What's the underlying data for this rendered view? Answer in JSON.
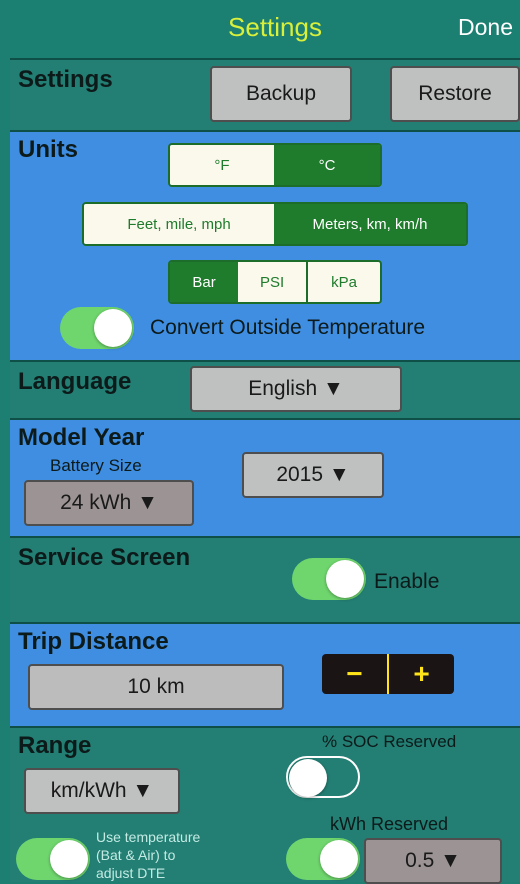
{
  "nav": {
    "title": "Settings",
    "done_label": "Done"
  },
  "settings": {
    "label": "Settings",
    "backup_label": "Backup",
    "restore_label": "Restore"
  },
  "units": {
    "label": "Units",
    "temperature_options": [
      "°F",
      "°C"
    ],
    "temperature_selected": "°C",
    "distance_options": [
      "Feet, mile, mph",
      "Meters, km, km/h"
    ],
    "distance_selected": "Meters, km, km/h",
    "pressure_options": [
      "Bar",
      "PSI",
      "kPa"
    ],
    "pressure_selected": "Bar",
    "convert_temp_label": "Convert Outside Temperature",
    "convert_temp_on": true
  },
  "language": {
    "label": "Language",
    "value": "English ▼"
  },
  "model_year": {
    "label": "Model Year",
    "battery_size_label": "Battery Size",
    "battery_size_value": "24 kWh ▼",
    "year_value": "2015 ▼"
  },
  "service_screen": {
    "label": "Service Screen",
    "enable_label": "Enable",
    "enabled": true
  },
  "trip_distance": {
    "label": "Trip Distance",
    "value": "10 km",
    "minus": "−",
    "plus": "+"
  },
  "range": {
    "label": "Range",
    "unit_value": "km/kWh ▼",
    "soc_reserved_label": "% SOC Reserved",
    "soc_reserved_on": false,
    "use_temp_line1": "Use temperature",
    "use_temp_line2": "(Bat & Air) to",
    "use_temp_line3": "adjust DTE",
    "use_temp_on": true,
    "kwh_reserved_label": "kWh Reserved",
    "kwh_reserved_on": true,
    "kwh_reserved_value": "0.5 ▼"
  },
  "colors": {
    "teal": "#237e73",
    "blue": "#3f8ee2",
    "title_yellow": "#d8ef3c",
    "segment_green": "#1f7c2c",
    "toggle_green": "#6fd66d",
    "stepper_yellow": "#ffe41a"
  }
}
